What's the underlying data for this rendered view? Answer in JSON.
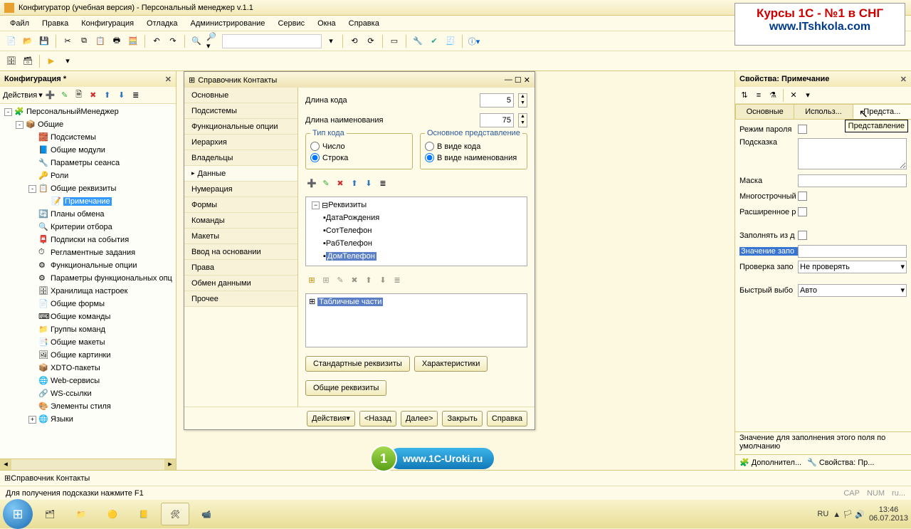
{
  "window": {
    "title": "Конфигуратор (учебная версия) - Персональный менеджер v.1.1"
  },
  "menu": [
    "Файл",
    "Правка",
    "Конфигурация",
    "Отладка",
    "Администрирование",
    "Сервис",
    "Окна",
    "Справка"
  ],
  "overlay": {
    "line1": "Курсы 1С - №1 в СНГ",
    "line2": "www.ITshkola.com"
  },
  "left_panel": {
    "title": "Конфигурация *",
    "actions_label": "Действия",
    "tree": [
      {
        "label": "ПерсональныйМенеджер",
        "ind": 0,
        "tog": "-"
      },
      {
        "label": "Общие",
        "ind": 1,
        "tog": "-"
      },
      {
        "label": "Подсистемы",
        "ind": 2
      },
      {
        "label": "Общие модули",
        "ind": 2
      },
      {
        "label": "Параметры сеанса",
        "ind": 2
      },
      {
        "label": "Роли",
        "ind": 2
      },
      {
        "label": "Общие реквизиты",
        "ind": 2,
        "tog": "-"
      },
      {
        "label": "Примечание",
        "ind": 3,
        "sel": true
      },
      {
        "label": "Планы обмена",
        "ind": 2
      },
      {
        "label": "Критерии отбора",
        "ind": 2
      },
      {
        "label": "Подписки на события",
        "ind": 2
      },
      {
        "label": "Регламентные задания",
        "ind": 2
      },
      {
        "label": "Функциональные опции",
        "ind": 2
      },
      {
        "label": "Параметры функциональных опц",
        "ind": 2
      },
      {
        "label": "Хранилища настроек",
        "ind": 2
      },
      {
        "label": "Общие формы",
        "ind": 2
      },
      {
        "label": "Общие команды",
        "ind": 2
      },
      {
        "label": "Группы команд",
        "ind": 2
      },
      {
        "label": "Общие макеты",
        "ind": 2
      },
      {
        "label": "Общие картинки",
        "ind": 2
      },
      {
        "label": "XDTO-пакеты",
        "ind": 2
      },
      {
        "label": "Web-сервисы",
        "ind": 2
      },
      {
        "label": "WS-ссылки",
        "ind": 2
      },
      {
        "label": "Элементы стиля",
        "ind": 2
      },
      {
        "label": "Языки",
        "ind": 2,
        "tog": "+"
      }
    ]
  },
  "dialog": {
    "title": "Справочник Контакты",
    "cats": [
      "Основные",
      "Подсистемы",
      "Функциональные опции",
      "Иерархия",
      "Владельцы",
      "Данные",
      "Нумерация",
      "Формы",
      "Команды",
      "Макеты",
      "Ввод на основании",
      "Права",
      "Обмен данными",
      "Прочее"
    ],
    "selected_cat": 5,
    "code_len_label": "Длина кода",
    "code_len": "5",
    "name_len_label": "Длина наименования",
    "name_len": "75",
    "group1_title": "Тип кода",
    "g1_opt1": "Число",
    "g1_opt2": "Строка",
    "group2_title": "Основное представление",
    "g2_opt1": "В виде кода",
    "g2_opt2": "В виде наименования",
    "tree1": [
      "Реквизиты",
      "ДатаРождения",
      "СотТелефон",
      "РабТелефон",
      "ДомТелефон"
    ],
    "tree2_label": "Табличные части",
    "btn_std": "Стандартные реквизиты",
    "btn_char": "Характеристики",
    "btn_common": "Общие реквизиты",
    "footer": {
      "actions": "Действия",
      "back": "<Назад",
      "next": "Далее>",
      "close": "Закрыть",
      "help": "Справка"
    }
  },
  "props": {
    "title": "Свойства: Примечание",
    "tabs": [
      "Основные",
      "Использ...",
      "Предста..."
    ],
    "tooltip": "Представление",
    "rows": {
      "pwd_mode": "Режим пароля",
      "hint": "Подсказка",
      "mask": "Маска",
      "multiline": "Многострочный",
      "extended": "Расширенное р",
      "fill_from": "Заполнять из д",
      "fill_value": "Значение запо",
      "check": "Проверка запо",
      "check_val": "Не проверять",
      "quick": "Быстрый выбо",
      "quick_val": "Авто"
    },
    "desc": "Значение для заполнения этого поля по умолчанию",
    "bottom_btn1": "Дополнител...",
    "bottom_btn2": "Свойства: Пр..."
  },
  "status_tab": "Справочник Контакты",
  "status_hint": "Для получения подсказки нажмите F1",
  "status_right": {
    "cap": "CAP",
    "num": "NUM",
    "ru": "ru..."
  },
  "tray": {
    "lang": "RU",
    "time": "13:46",
    "date": "06.07.2013"
  },
  "banner": {
    "num": "1",
    "text": "www.1C-Uroki.ru"
  }
}
